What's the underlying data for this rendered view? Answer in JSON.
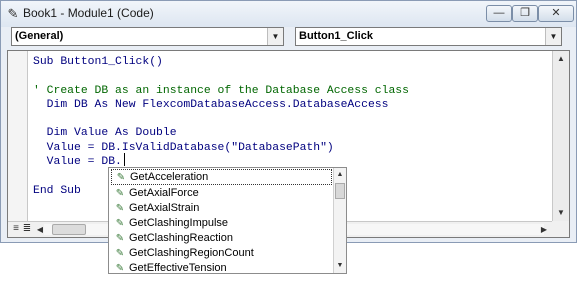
{
  "window": {
    "title": "Book1 - Module1 (Code)",
    "icon": "vba-module-icon",
    "controls": {
      "minimize": "—",
      "restore": "❐",
      "close": "✕"
    }
  },
  "combos": {
    "object": {
      "value": "(General)"
    },
    "procedure": {
      "value": "Button1_Click"
    }
  },
  "code": {
    "lines": [
      "Sub Button1_Click()",
      "",
      "' Create DB as an instance of the Database Access class",
      "  Dim DB As New FlexcomDatabaseAccess.DatabaseAccess",
      "",
      "  Dim Value As Double",
      "  Value = DB.IsValidDatabase(\"DatabasePath\")",
      "  Value = DB.",
      "",
      "End Sub"
    ]
  },
  "autocomplete": {
    "icon": "method-icon",
    "items": [
      "GetAcceleration",
      "GetAxialForce",
      "GetAxialStrain",
      "GetClashingImpulse",
      "GetClashingReaction",
      "GetClashingRegionCount",
      "GetEffectiveTension"
    ],
    "selected_index": 0
  },
  "colors": {
    "keyword": "#00007f",
    "comment": "#006600",
    "accent": "#dde6f1"
  }
}
